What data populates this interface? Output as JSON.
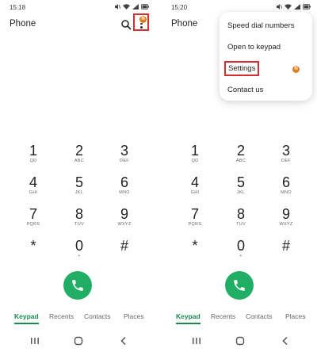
{
  "left": {
    "status": {
      "time": "15:18"
    },
    "app_title": "Phone"
  },
  "right": {
    "status": {
      "time": "15:20"
    },
    "app_title": "Phone",
    "menu": {
      "items": [
        "Speed dial numbers",
        "Open to keypad",
        "Settings",
        "Contact us"
      ],
      "highlighted": "Settings",
      "settings_badge": "N"
    }
  },
  "more_badge": "N",
  "keys": [
    {
      "digit": "1",
      "letters": "QD"
    },
    {
      "digit": "2",
      "letters": "ABC"
    },
    {
      "digit": "3",
      "letters": "DEF"
    },
    {
      "digit": "4",
      "letters": "GHI"
    },
    {
      "digit": "5",
      "letters": "JKL"
    },
    {
      "digit": "6",
      "letters": "MNO"
    },
    {
      "digit": "7",
      "letters": "PQRS"
    },
    {
      "digit": "8",
      "letters": "TUV"
    },
    {
      "digit": "9",
      "letters": "WXYZ"
    },
    {
      "digit": "*",
      "letters": ""
    },
    {
      "digit": "0",
      "letters": "+"
    },
    {
      "digit": "#",
      "letters": ""
    }
  ],
  "tabs": [
    "Keypad",
    "Recents",
    "Contacts",
    "Places"
  ],
  "active_tab": "Keypad",
  "colors": {
    "accent": "#1fae63",
    "highlight": "#d32f2f",
    "badge": "#e07b1f"
  }
}
